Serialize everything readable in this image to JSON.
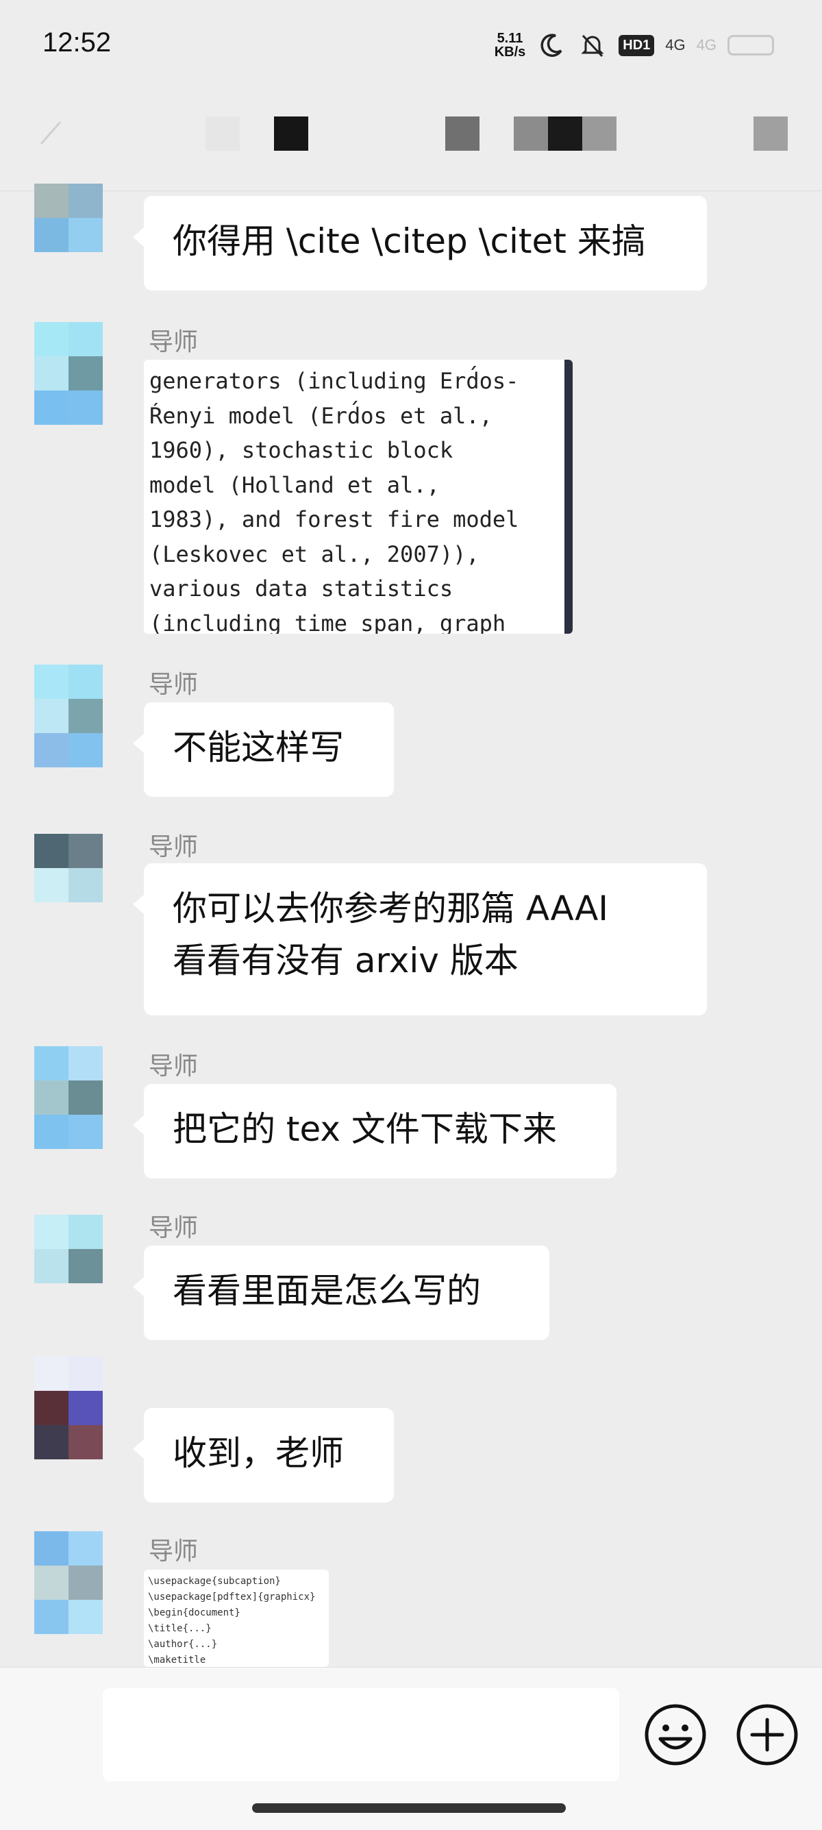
{
  "status_bar": {
    "time": "12:52",
    "net_speed_value": "5.11",
    "net_speed_unit": "KB/s",
    "hd_label": "HD1",
    "signal_1": "4G",
    "signal_2": "4G"
  },
  "messages": [
    {
      "type": "text",
      "sender": "",
      "text": "你得用 \\cite \\citep \\citet 来搞"
    },
    {
      "type": "image",
      "sender": "导师",
      "image_text": "generators (including Erd́os-\nŔenyi model (Erd́os et al.,\n1960), stochastic block\nmodel (Holland et al.,\n1983), and forest fire model\n(Leskovec et al., 2007)),\nvarious data statistics\n(including time span, graph"
    },
    {
      "type": "text",
      "sender": "导师",
      "text": "不能这样写"
    },
    {
      "type": "text",
      "sender": "导师",
      "lines": [
        "你可以去你参考的那篇 AAAI",
        "看看有没有 arxiv 版本"
      ]
    },
    {
      "type": "text",
      "sender": "导师",
      "text": "把它的 tex 文件下载下来"
    },
    {
      "type": "text",
      "sender": "导师",
      "text": "看看里面是怎么写的"
    },
    {
      "type": "text",
      "sender": "",
      "text": "收到，老师"
    },
    {
      "type": "image",
      "sender": "导师",
      "image_text": "\\usepackage{subcaption}\n\\usepackage[pdftex]{graphicx}\n\\begin{document}\n\\title{...}\n\\author{...}\n\\maketitle"
    }
  ],
  "input": {
    "value": "",
    "placeholder": ""
  },
  "icons": {
    "back": "back-arrow-icon",
    "emoji": "emoji-icon",
    "plus": "add-icon",
    "moon": "moon-icon",
    "mute": "bell-off-icon",
    "battery": "battery-icon"
  }
}
